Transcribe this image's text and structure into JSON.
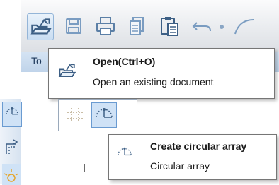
{
  "toolbar": {
    "icons": [
      "open-icon",
      "save-icon",
      "print-icon",
      "copy-icon",
      "paste-icon",
      "undo-icon"
    ]
  },
  "band": {
    "text": "To"
  },
  "tooltip_open": {
    "title": "Open(Ctrl+O)",
    "description": "Open an existing document"
  },
  "left_toolbar": {
    "icons": [
      "circular-array-icon",
      "offset-icon",
      "sun-icon"
    ]
  },
  "sub_toolbar": {
    "icons": [
      "rectangular-array-icon",
      "circular-array-icon"
    ]
  },
  "tooltip_circular": {
    "title": "Create circular array",
    "description": "Circular array"
  },
  "colors": {
    "toolbar_icon": "#5b7fa6",
    "selection_fill": "#cfe2f6",
    "selection_border": "#6a9bd1",
    "band": "#c9dbef",
    "tooltip_border": "#767676"
  }
}
